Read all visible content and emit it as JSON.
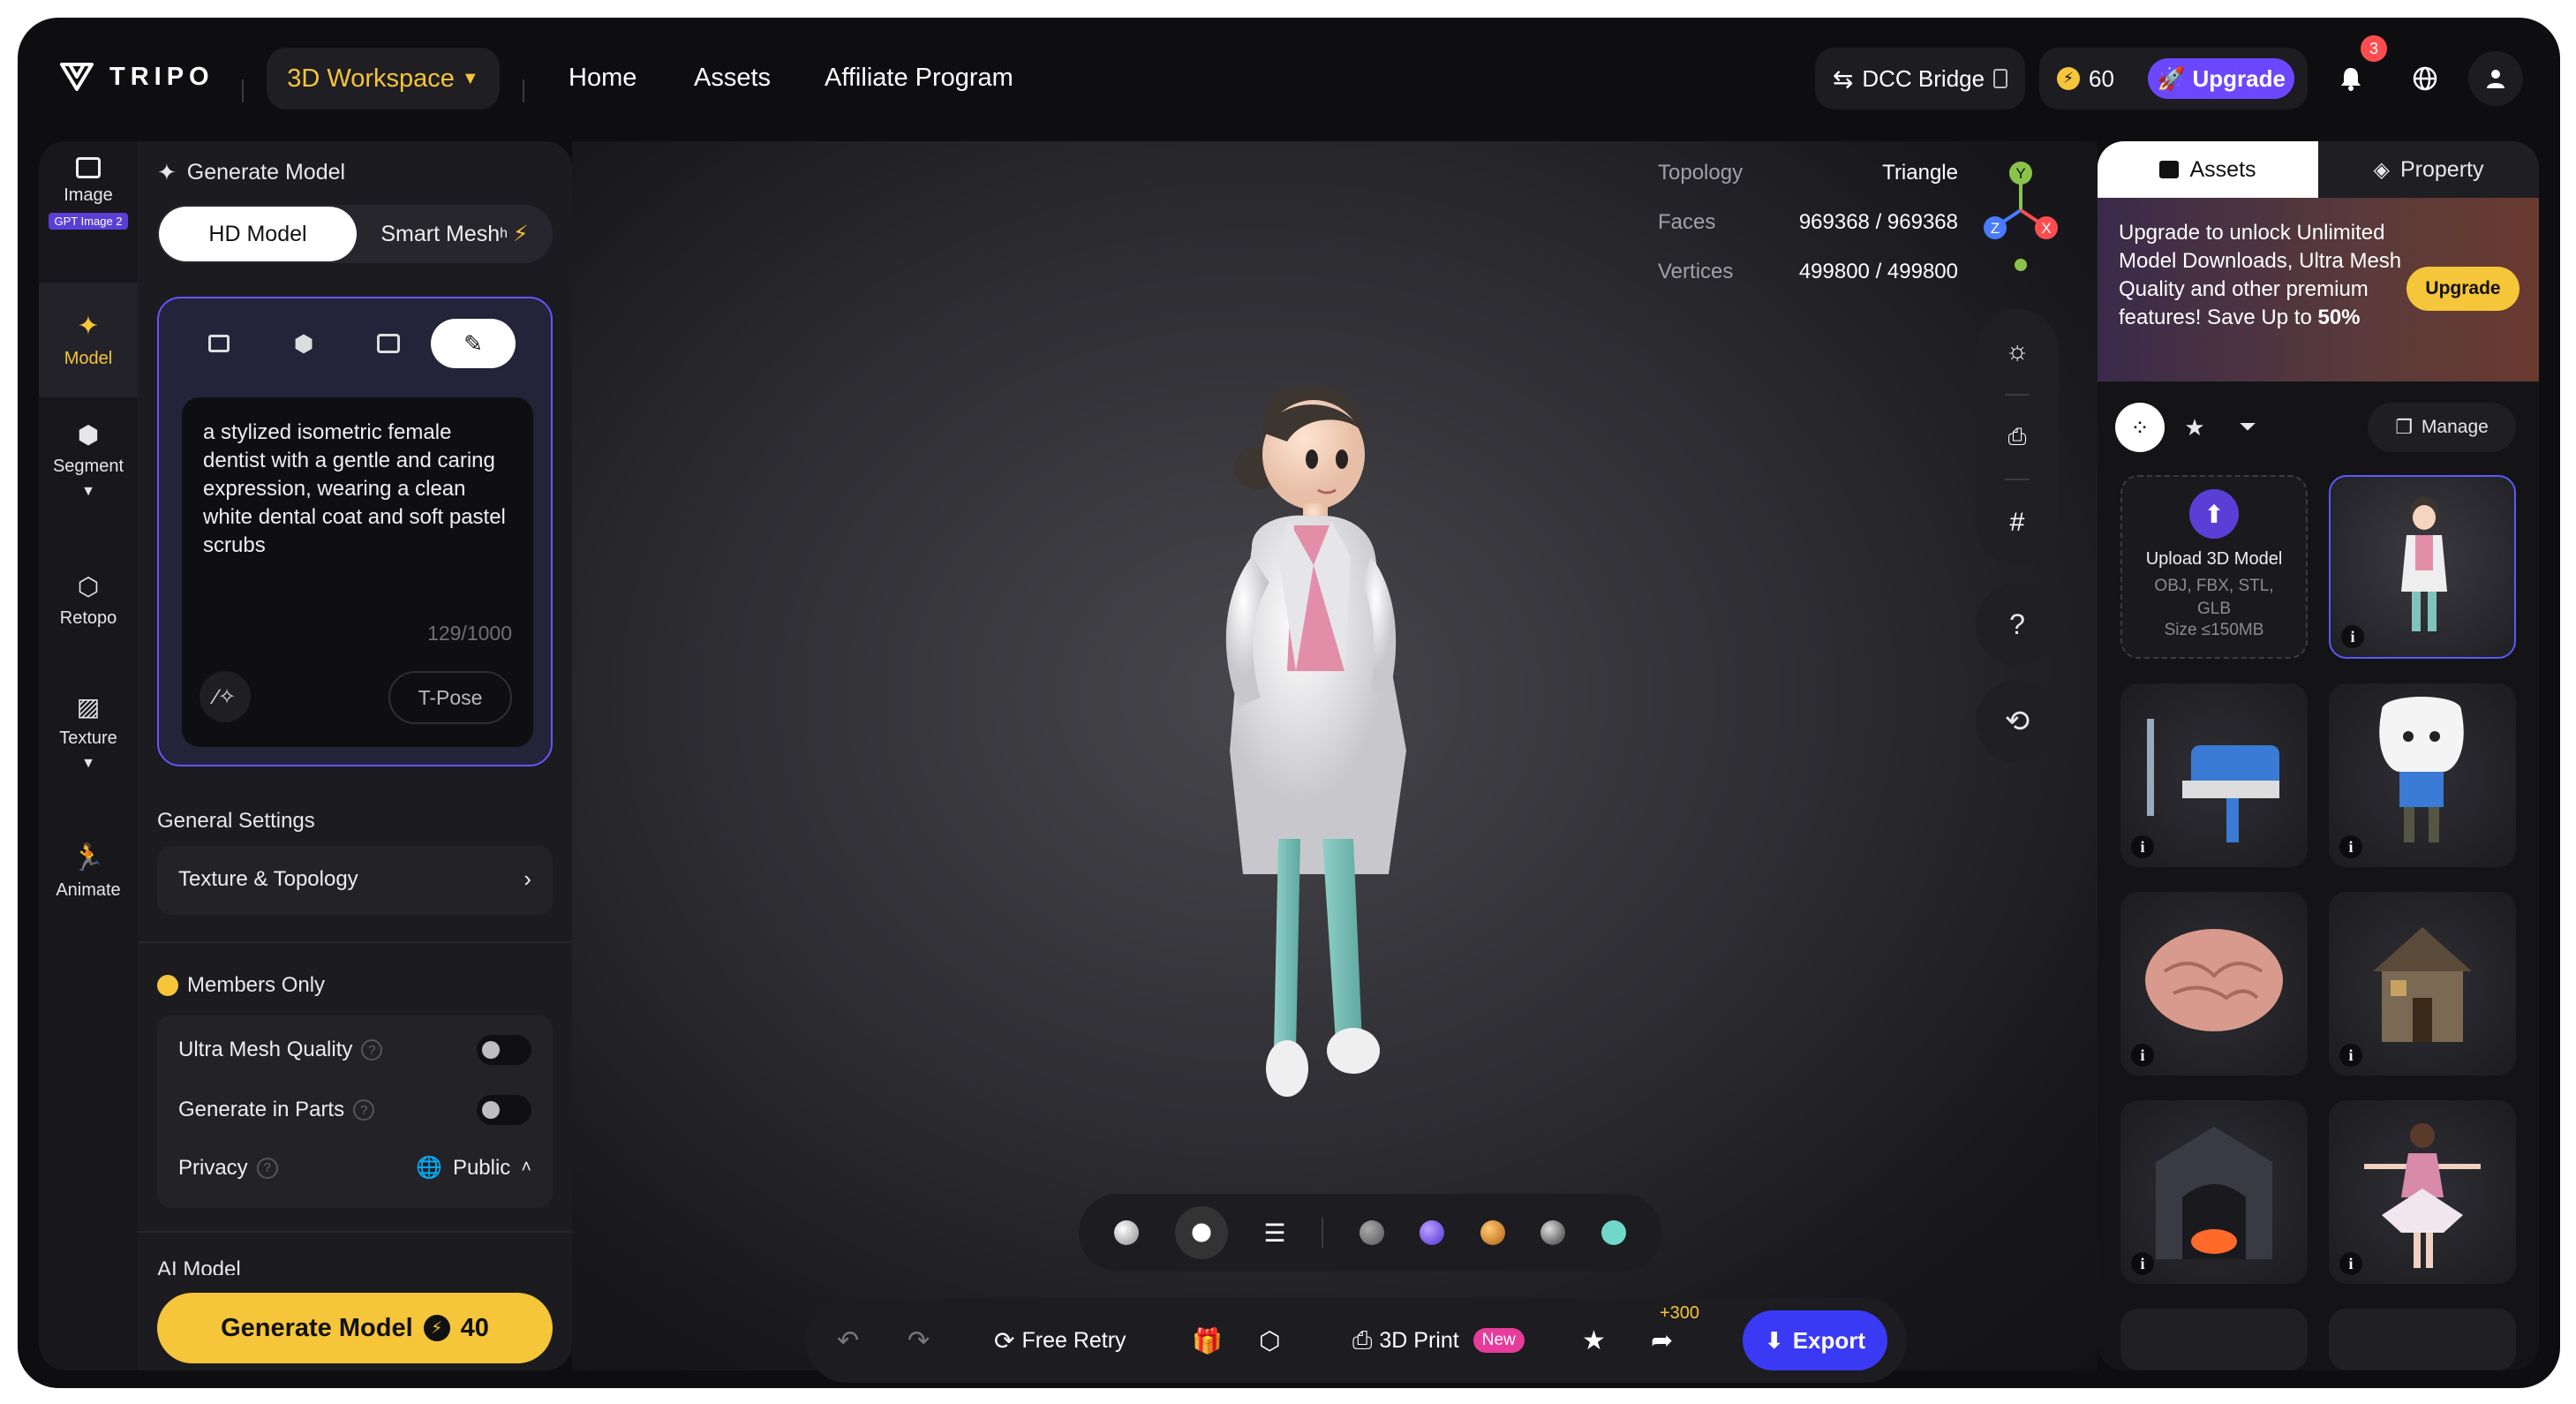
{
  "header": {
    "logo_text": "TRIPO",
    "workspace": "3D Workspace",
    "nav": [
      "Home",
      "Assets",
      "Affiliate Program"
    ],
    "dcc_bridge": "DCC Bridge",
    "credits": "60",
    "upgrade": "Upgrade",
    "notifications_count": "3"
  },
  "leftbar": {
    "items": [
      {
        "label": "Image",
        "tag": "GPT Image 2"
      },
      {
        "label": "Model"
      },
      {
        "label": "Segment"
      },
      {
        "label": "Retopo"
      },
      {
        "label": "Texture"
      },
      {
        "label": "Animate"
      }
    ]
  },
  "panel": {
    "title": "Generate Model",
    "mode_hd": "HD Model",
    "mode_smart": "Smart Mesh",
    "mode_smart_sup": "h",
    "prompt": "a stylized isometric female dentist with a gentle and caring expression, wearing a clean white dental coat and soft pastel scrubs",
    "prompt_count": "129/1000",
    "tpose": "T-Pose",
    "general_settings": "General Settings",
    "texture_topology": "Texture & Topology",
    "members_only": "Members Only",
    "ultra_mesh": "Ultra Mesh Quality",
    "gen_parts": "Generate in Parts",
    "privacy": "Privacy",
    "privacy_value": "Public",
    "ai_model": "AI Model",
    "generate_label": "Generate Model",
    "generate_cost": "40"
  },
  "viewport": {
    "topology_label": "Topology",
    "topology_value": "Triangle",
    "faces_label": "Faces",
    "faces_value": "969368 / 969368",
    "vertices_label": "Vertices",
    "vertices_value": "499800 / 499800",
    "axis_y": "Y",
    "axis_z": "Z",
    "axis_x": "X"
  },
  "bottombar": {
    "free_retry": "Free Retry",
    "print": "3D Print",
    "new_tag": "New",
    "share_bonus": "+300",
    "export": "Export"
  },
  "rightpanel": {
    "tab_assets": "Assets",
    "tab_property": "Property",
    "promo_pre": "Upgrade to unlock Unlimited Model Downloads, Ultra Mesh Quality and other premium features! Save Up to ",
    "promo_pct": "50%",
    "promo_button": "Upgrade",
    "manage": "Manage",
    "upload_title": "Upload 3D Model",
    "upload_formats": "OBJ, FBX, STL, GLB",
    "upload_size": "Size ≤150MB"
  }
}
